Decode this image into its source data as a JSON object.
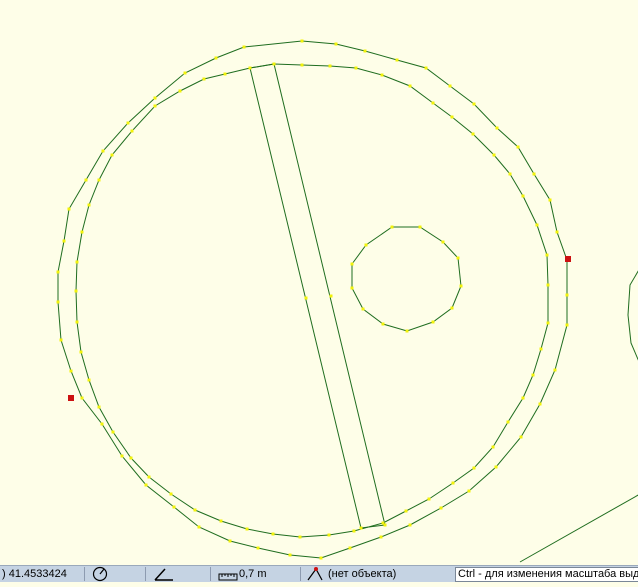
{
  "statusbar": {
    "coordinate": ") 41.4533424",
    "measure": "0,7 m",
    "object": "(нет объекта)",
    "hint": "Ctrl - для изменения масштаба выде"
  },
  "colors": {
    "background": "#fefee8",
    "outline": "#1f6d1f",
    "vertex": "#f2f20a",
    "selected_vertex": "#cc1111",
    "statusbar": "#c5d3e3"
  },
  "icons": [
    "compass-icon",
    "angle-icon",
    "ruler-icon",
    "cursor-snap-icon"
  ]
}
